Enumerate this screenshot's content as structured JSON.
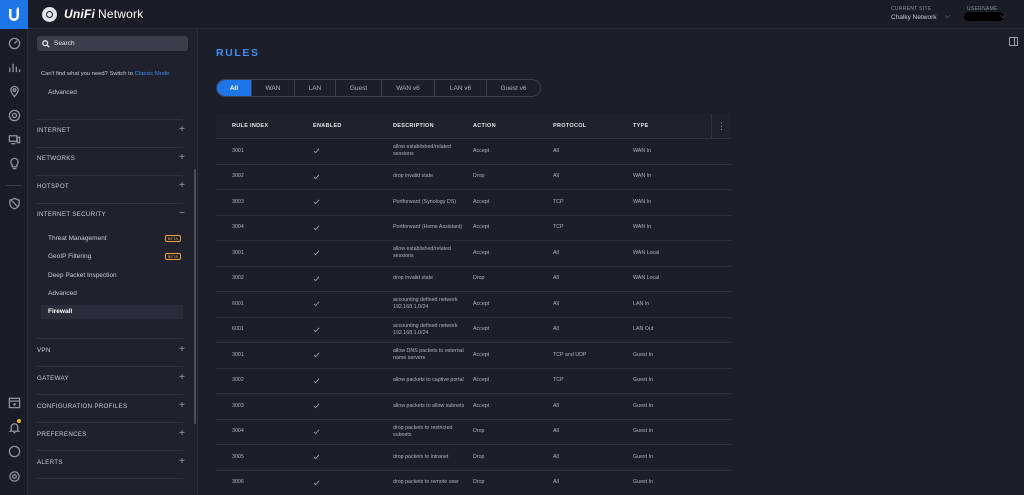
{
  "app": {
    "name_brand": "UniFi",
    "name_rest": "Network",
    "site_label": "CURRENT SITE",
    "site_value": "Chalky Network",
    "user_label": "USERNAME"
  },
  "sidebar": {
    "search_placeholder": "Search",
    "classic_hint_text": "Can't find what you need? Switch to ",
    "classic_hint_link": "Classic Mode",
    "top_item": "Advanced",
    "sections": [
      {
        "label": "INTERNET",
        "toggle": "+"
      },
      {
        "label": "NETWORKS",
        "toggle": "+"
      },
      {
        "label": "HOTSPOT",
        "toggle": "+"
      },
      {
        "label": "INTERNET SECURITY",
        "toggle": "−"
      },
      {
        "label": "VPN",
        "toggle": "+"
      },
      {
        "label": "GATEWAY",
        "toggle": "+"
      },
      {
        "label": "CONFIGURATION PROFILES",
        "toggle": "+"
      },
      {
        "label": "PREFERENCES",
        "toggle": "+"
      },
      {
        "label": "ALERTS",
        "toggle": "+"
      }
    ],
    "security_items": [
      {
        "label": "Threat Management",
        "badge": "BETA"
      },
      {
        "label": "GeoIP Filtering",
        "badge": "BETA"
      },
      {
        "label": "Deep Packet Inspection",
        "badge": ""
      },
      {
        "label": "Advanced",
        "badge": ""
      },
      {
        "label": "Firewall",
        "badge": ""
      }
    ]
  },
  "main": {
    "title": "RULES",
    "tabs": [
      {
        "label": "All",
        "active": true
      },
      {
        "label": "WAN",
        "active": false
      },
      {
        "label": "LAN",
        "active": false
      },
      {
        "label": "Guest",
        "active": false
      },
      {
        "label": "WAN v6",
        "active": false
      },
      {
        "label": "LAN v6",
        "active": false
      },
      {
        "label": "Guest v6",
        "active": false
      }
    ],
    "columns": [
      "RULE INDEX",
      "ENABLED",
      "DESCRIPTION",
      "ACTION",
      "PROTOCOL",
      "TYPE"
    ],
    "kebab": "⋮",
    "rows": [
      {
        "index": "3001",
        "enabled": true,
        "description": "allow established/related sessions",
        "action": "Accept",
        "protocol": "All",
        "type": "WAN In"
      },
      {
        "index": "3002",
        "enabled": true,
        "description": "drop invalid state",
        "action": "Drop",
        "protocol": "All",
        "type": "WAN In"
      },
      {
        "index": "3003",
        "enabled": true,
        "description": "Portforward (Synology DS)",
        "action": "Accept",
        "protocol": "TCP",
        "type": "WAN In"
      },
      {
        "index": "3004",
        "enabled": true,
        "description": "Portforward (Home Assistant)",
        "action": "Accept",
        "protocol": "TCP",
        "type": "WAN In"
      },
      {
        "index": "3001",
        "enabled": true,
        "description": "allow established/related sessions",
        "action": "Accept",
        "protocol": "All",
        "type": "WAN Local"
      },
      {
        "index": "3002",
        "enabled": true,
        "description": "drop invalid state",
        "action": "Drop",
        "protocol": "All",
        "type": "WAN Local"
      },
      {
        "index": "6001",
        "enabled": true,
        "description": "accounting defined network 192.168.1.0/24",
        "action": "Accept",
        "protocol": "All",
        "type": "LAN In"
      },
      {
        "index": "6001",
        "enabled": true,
        "description": "accounting defined network 192.168.1.0/24",
        "action": "Accept",
        "protocol": "All",
        "type": "LAN Out"
      },
      {
        "index": "3001",
        "enabled": true,
        "description": "allow DNS packets to external name servers",
        "action": "Accept",
        "protocol": "TCP and UDP",
        "type": "Guest In"
      },
      {
        "index": "3002",
        "enabled": true,
        "description": "allow packets to captive portal",
        "action": "Accept",
        "protocol": "TCP",
        "type": "Guest In"
      },
      {
        "index": "3003",
        "enabled": true,
        "description": "allow packets to allow subnets",
        "action": "Accept",
        "protocol": "All",
        "type": "Guest In"
      },
      {
        "index": "3004",
        "enabled": true,
        "description": "drop packets to restricted subnets",
        "action": "Drop",
        "protocol": "All",
        "type": "Guest In"
      },
      {
        "index": "3005",
        "enabled": true,
        "description": "drop packets to intranet",
        "action": "Drop",
        "protocol": "All",
        "type": "Guest In"
      },
      {
        "index": "3006",
        "enabled": true,
        "description": "drop packets to remote user",
        "action": "Drop",
        "protocol": "All",
        "type": "Guest In"
      }
    ]
  },
  "colors": {
    "accent": "#1e75e8",
    "title": "#3b8cf5",
    "beta": "#f2a23a",
    "notification": "#f2b31b"
  }
}
